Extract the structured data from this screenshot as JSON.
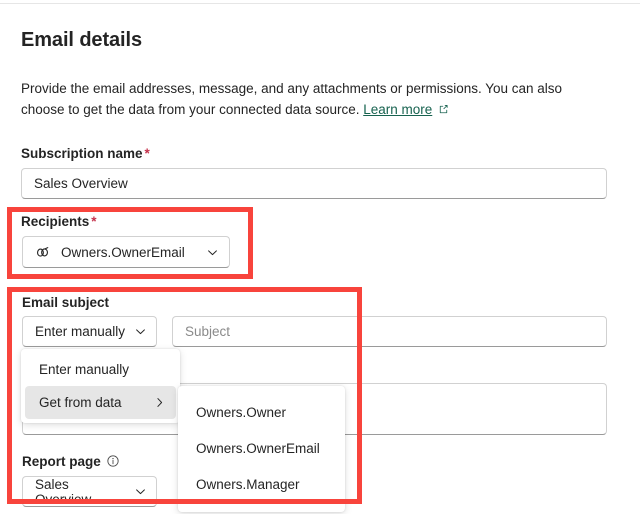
{
  "header": {
    "title": "Email details",
    "description_part1": "Provide the email addresses, message, and any attachments or permissions. You can also choose to get the data from your connected data source. ",
    "learn_more_label": "Learn more",
    "external_link_icon": "external-link-icon"
  },
  "fields": {
    "subscription": {
      "label": "Subscription name",
      "required_marker": "*",
      "value": "Sales Overview",
      "placeholder": "Subscription name"
    },
    "recipients": {
      "label": "Recipients",
      "required_marker": "*",
      "value": "Owners.OwnerEmail",
      "icon": "link-icon",
      "chevron": "chevron-down-icon"
    },
    "email_subject": {
      "label": "Email subject",
      "mode_value": "Enter manually",
      "subject_placeholder": "Subject",
      "subject_value": "",
      "chevron": "chevron-down-icon"
    },
    "message": {
      "value": "",
      "placeholder": ""
    },
    "report_page": {
      "label": "Report page",
      "info_icon": "info-icon",
      "value": "Sales Overview",
      "chevron": "chevron-down-icon"
    }
  },
  "subject_menu": {
    "items": [
      {
        "label": "Enter manually",
        "selected": false,
        "has_submenu": false
      },
      {
        "label": "Get from data",
        "selected": true,
        "has_submenu": true,
        "submenu_icon": "chevron-right-icon"
      }
    ]
  },
  "data_submenu": {
    "items": [
      {
        "label": "Owners.Owner"
      },
      {
        "label": "Owners.OwnerEmail"
      },
      {
        "label": "Owners.Manager"
      }
    ]
  },
  "annotations": {
    "highlight_color": "#f8443c",
    "boxes": [
      {
        "name": "recipients-highlight"
      },
      {
        "name": "email-subject-highlight"
      }
    ]
  },
  "colors": {
    "link": "#17624f",
    "required": "#c4314b",
    "text": "#242424",
    "border": "#d1d1d1"
  }
}
